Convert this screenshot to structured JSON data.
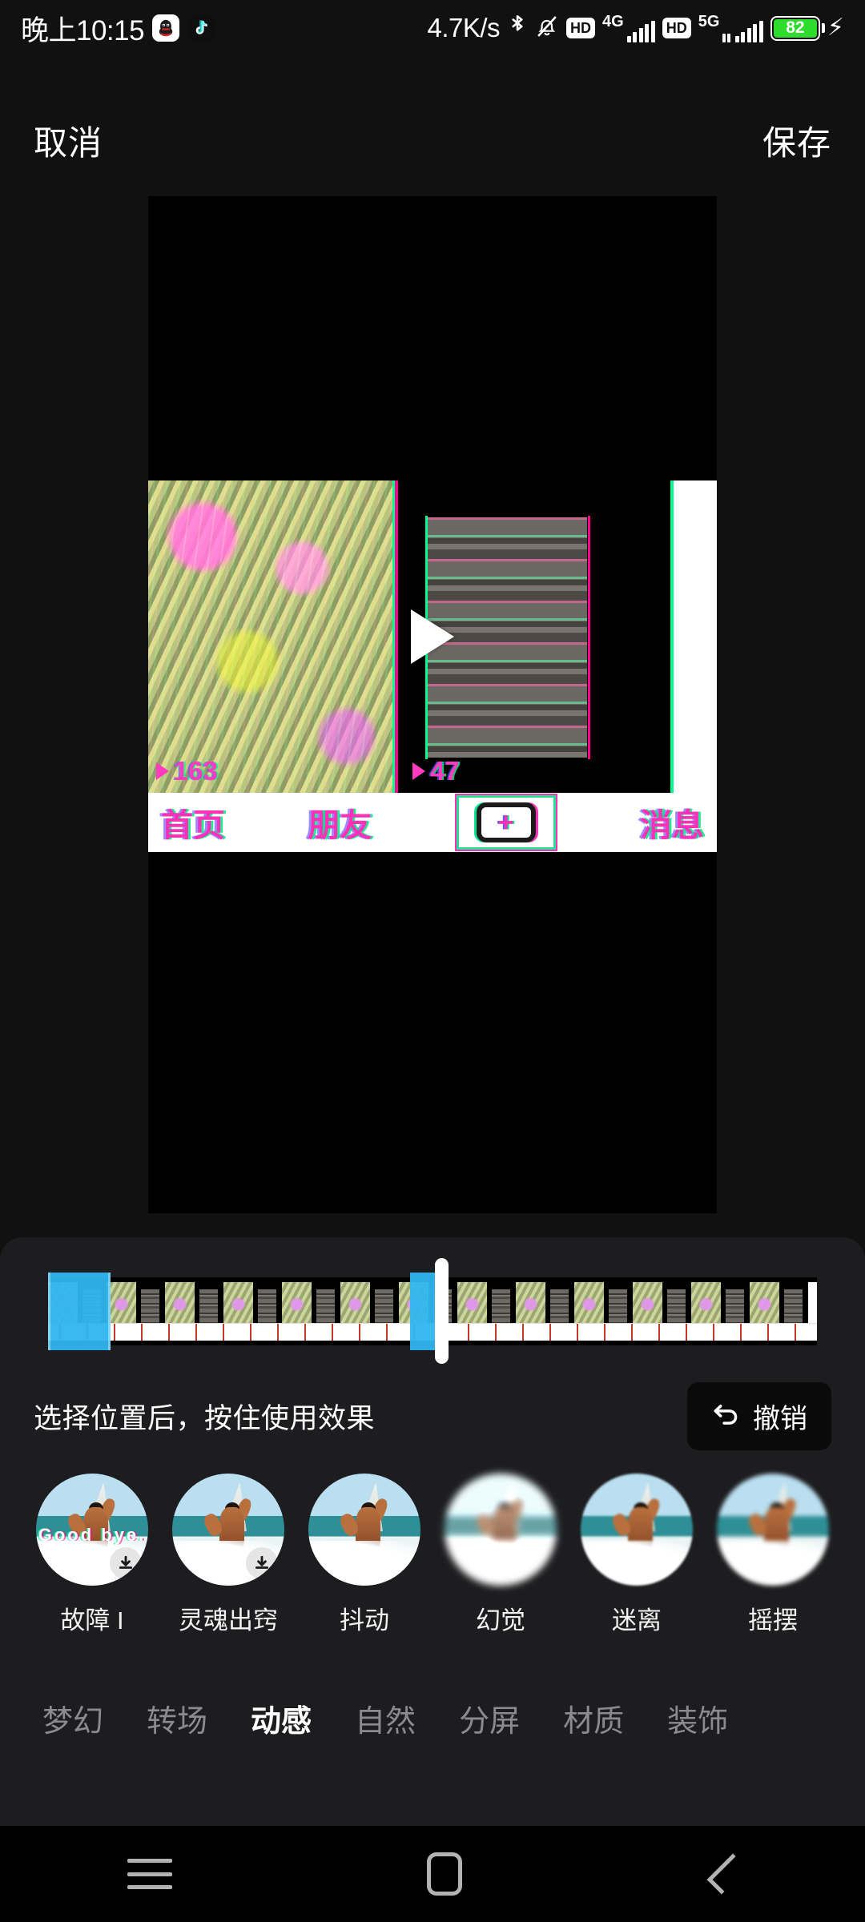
{
  "status_bar": {
    "time": "晚上10:15",
    "app_icons": [
      "qq-icon",
      "tiktok-icon"
    ],
    "network_speed": "4.7K/s",
    "icons": [
      "bluetooth-icon",
      "mute-icon"
    ],
    "sim1": {
      "hd": "HD",
      "gen": "4G"
    },
    "sim2": {
      "hd": "HD",
      "gen": "5G"
    },
    "battery_percent": "82",
    "battery_color": "#2ddc2d",
    "charging": true
  },
  "top_bar": {
    "cancel_label": "取消",
    "save_label": "保存"
  },
  "preview": {
    "play_icon": "play-icon",
    "like_count_left": "163",
    "like_count_right": "47",
    "inner_tabs": [
      "首页",
      "朋友",
      "消息"
    ],
    "plus_label": "+"
  },
  "timeline": {
    "frame_count": 13,
    "playhead_position_label": "",
    "selection_color": "#30b6f0"
  },
  "hint": {
    "text": "选择位置后，按住使用效果",
    "undo_label": "撤销",
    "undo_icon": "undo-arrow-icon"
  },
  "effects": [
    {
      "label": "故障 I",
      "badge": "download-icon",
      "overlay_text": "Good bye."
    },
    {
      "label": "灵魂出窍",
      "badge": "download-icon",
      "overlay_text": ""
    },
    {
      "label": "抖动",
      "badge": "",
      "overlay_text": ""
    },
    {
      "label": "幻觉",
      "badge": "",
      "overlay_text": ""
    },
    {
      "label": "迷离",
      "badge": "",
      "overlay_text": ""
    },
    {
      "label": "摇摆",
      "badge": "",
      "overlay_text": ""
    }
  ],
  "categories": [
    {
      "label": "梦幻",
      "active": false
    },
    {
      "label": "转场",
      "active": false
    },
    {
      "label": "动感",
      "active": true
    },
    {
      "label": "自然",
      "active": false
    },
    {
      "label": "分屏",
      "active": false
    },
    {
      "label": "材质",
      "active": false
    },
    {
      "label": "装饰",
      "active": false
    }
  ],
  "nav_bar": {
    "recents": "recents-icon",
    "home": "home-icon",
    "back": "back-icon"
  }
}
